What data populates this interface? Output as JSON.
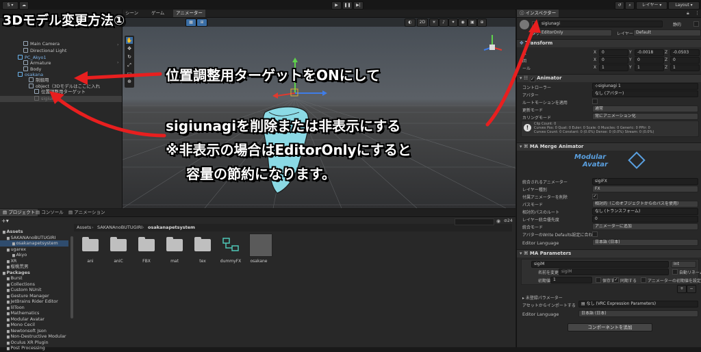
{
  "toolbar": {
    "account": "S",
    "layers": "レイヤー",
    "layout": "Layout"
  },
  "title_overlay": "3Dモデル変更方法①",
  "hierarchy": {
    "items": [
      {
        "label": "Main Camera",
        "indent": 34,
        "type": "obj"
      },
      {
        "label": "Directional Light",
        "indent": 34,
        "type": "obj"
      },
      {
        "label": "PC_Akyo1",
        "indent": 26,
        "type": "prefab"
      },
      {
        "label": "Armature",
        "indent": 34,
        "type": "obj"
      },
      {
        "label": "Body",
        "indent": 34,
        "type": "obj"
      },
      {
        "label": "osakana",
        "indent": 26,
        "type": "prefab"
      },
      {
        "label": "制御用",
        "indent": 42,
        "type": "obj"
      },
      {
        "label": "object（3Dモデルはここに入れ",
        "indent": 42,
        "type": "obj"
      },
      {
        "label": "位置調整用ターゲット",
        "indent": 50,
        "type": "obj"
      },
      {
        "label": "sigiunagi",
        "indent": 50,
        "type": "dim"
      }
    ]
  },
  "scene": {
    "tab": "シーン",
    "game": "ゲーム",
    "animator": "アニメーター",
    "mode_2d": "2D"
  },
  "annotations": {
    "line1": "位置調整用ターゲットをONにして",
    "line2": "sigiunagiを削除または非表示にする",
    "line3": "※非表示の場合はEditorOnlyにすると",
    "line4": "容量の節約になります。"
  },
  "project": {
    "tabs": [
      "プロジェクト",
      "コンソール",
      "アニメーション"
    ],
    "breadcrumb": [
      "Assets",
      "SAKANAnoBUTUGIRI",
      "osakanapetsystem"
    ],
    "slider_count": "24",
    "tree": [
      {
        "label": "Assets",
        "indent": 4,
        "bold": true
      },
      {
        "label": "SAKANAnoBUTUGIRI",
        "indent": 10,
        "bold": false
      },
      {
        "label": "osakanapetsystem",
        "indent": 18,
        "bold": false
      },
      {
        "label": "ugarex",
        "indent": 10,
        "bold": false
      },
      {
        "label": "Akyo",
        "indent": 18,
        "bold": false
      },
      {
        "label": "XR",
        "indent": 10,
        "bold": false
      },
      {
        "label": "桜桃荒男",
        "indent": 10,
        "bold": false
      },
      {
        "label": "Packages",
        "indent": 4,
        "bold": true
      },
      {
        "label": "Burst",
        "indent": 10,
        "bold": false
      },
      {
        "label": "Collections",
        "indent": 10,
        "bold": false
      },
      {
        "label": "Custom NUnit",
        "indent": 10,
        "bold": false
      },
      {
        "label": "Gesture Manager",
        "indent": 10,
        "bold": false
      },
      {
        "label": "JetBrains Rider Editor",
        "indent": 10,
        "bold": false
      },
      {
        "label": "lilToon",
        "indent": 10,
        "bold": false
      },
      {
        "label": "Mathematics",
        "indent": 10,
        "bold": false
      },
      {
        "label": "Modular Avatar",
        "indent": 10,
        "bold": false
      },
      {
        "label": "Mono Cecil",
        "indent": 10,
        "bold": false
      },
      {
        "label": "Newtonsoft Json",
        "indent": 10,
        "bold": false
      },
      {
        "label": "Non-Destructive Modular",
        "indent": 10,
        "bold": false
      },
      {
        "label": "Oculus XR Plugin",
        "indent": 10,
        "bold": false
      },
      {
        "label": "Post Processing",
        "indent": 10,
        "bold": false
      }
    ],
    "assets": [
      {
        "name": "ani",
        "kind": "folder"
      },
      {
        "name": "aniC",
        "kind": "folder"
      },
      {
        "name": "FBX",
        "kind": "folder"
      },
      {
        "name": "mat",
        "kind": "folder"
      },
      {
        "name": "tex",
        "kind": "folder"
      },
      {
        "name": "dummyFX",
        "kind": "controller"
      },
      {
        "name": "osakane",
        "kind": "prefab"
      }
    ]
  },
  "inspector": {
    "tab": "インスペクター",
    "object_name": "sigiunagi",
    "static_label": "静的",
    "tag_label": "タグ",
    "tag_value": "EditorOnly",
    "layer_label": "レイヤー",
    "layer_value": "Default",
    "transform": {
      "title": "Transform",
      "rows": [
        {
          "label": "位",
          "x": "0",
          "y": "-0.0018",
          "z": "-0.0503"
        },
        {
          "label": "回",
          "x": "0",
          "y": "0",
          "z": "0"
        },
        {
          "label": "ール",
          "x": "1",
          "y": "1",
          "z": "1"
        }
      ]
    },
    "animator": {
      "title": "Animator",
      "controller_label": "コントローラー",
      "controller_value": "sigiunagi 1",
      "avatar_label": "アバター",
      "avatar_value": "なし (アバター)",
      "root_motion_label": "ルートモーションを適用",
      "update_label": "更新モード",
      "update_value": "通常",
      "culling_label": "カリングモード",
      "culling_value": "常にアニメーション化",
      "info": [
        "Clip Count: 0",
        "Curves Pos: 0 Quat: 0 Euler: 0 Scale: 0 Muscles: 0 Generic: 0 PPtr: 0",
        "Curves Count: 0 Constant: 0 (0.0%) Dense: 0 (0.0%) Stream: 0 (0.0%)"
      ]
    },
    "merge_animator": {
      "title": "MA Merge Animator",
      "logo_top": "Modular",
      "logo_bottom": "Avatar",
      "rows": [
        {
          "label": "統合されるアニメーター",
          "value": "sigiFX",
          "kind": "field"
        },
        {
          "label": "レイヤー種別",
          "value": "FX",
          "kind": "dd"
        },
        {
          "label": "付属アニメーターを削除",
          "value": "✓",
          "kind": "chk"
        },
        {
          "label": "パスモード",
          "value": "相対的（このオブジェクトからのパスを使用）",
          "kind": "dd"
        },
        {
          "label": "相対的パスのルート",
          "value": "なし (トランスフォーム)",
          "kind": "field"
        },
        {
          "label": "レイヤー統合優先度",
          "value": "0",
          "kind": "field"
        },
        {
          "label": "統合モード",
          "value": "アニメーターに追加",
          "kind": "dd"
        },
        {
          "label": "アバターのWrite Defaults設定に合わ",
          "value": "",
          "kind": "chk"
        }
      ],
      "editor_language_label": "Editor Language",
      "editor_language_value": "日本語 (日本)"
    },
    "parameters": {
      "title": "MA Parameters",
      "param_name": "sigiM",
      "param_type": "Int",
      "rename_label": "名前を変更",
      "rename_value": "sigiM",
      "auto_rename": "自動リネーム",
      "default_label": "初期値",
      "default_value": "1",
      "saved_label": "保存する",
      "synced_label": "同期する",
      "anim_default_label": "アニメーターの初期値を設定",
      "unused_label": "未登録パラメーター",
      "import_label": "アセットからインポートする",
      "import_value": "なし (VRC Expression Parameters)",
      "editor_language_label": "Editor Language",
      "editor_language_value": "日本語 (日本)",
      "add_component": "コンポーネントを追加"
    }
  }
}
